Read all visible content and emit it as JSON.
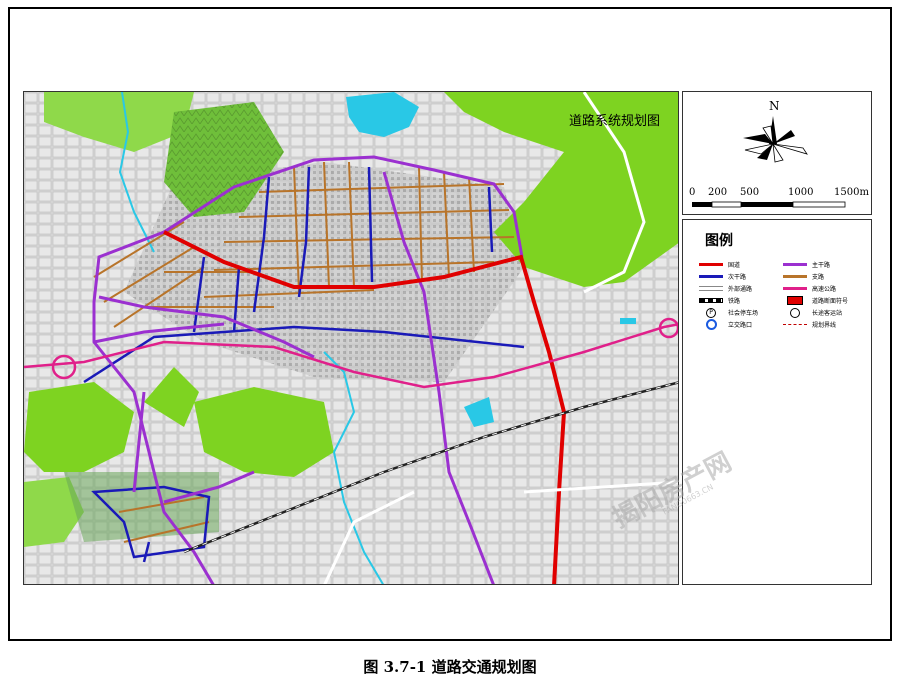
{
  "map": {
    "title": "道路系统规划图",
    "colors": {
      "national_road": "#e00000",
      "main_road": "#9b30d0",
      "secondary_road": "#1a1ab8",
      "branch_road": "#b8742a",
      "expressway": "#e0208a",
      "green": "#7ed321",
      "water": "#29c8e6",
      "railway": "#222222"
    }
  },
  "scale_bar": {
    "north_label": "N",
    "ticks": [
      "0",
      "200",
      "500",
      "1000",
      "1500m"
    ]
  },
  "legend": {
    "title": "图例",
    "items": [
      {
        "label": "国道",
        "symbol": "red-line-icon"
      },
      {
        "label": "主干路",
        "symbol": "purple-line-icon"
      },
      {
        "label": "次干路",
        "symbol": "blue-line-icon"
      },
      {
        "label": "支路",
        "symbol": "orange-line-icon"
      },
      {
        "label": "外部通路",
        "symbol": "gray-double-line-icon"
      },
      {
        "label": "高速公路",
        "symbol": "magenta-line-icon"
      },
      {
        "label": "铁路",
        "symbol": "railway-icon"
      },
      {
        "label": "道路断面符号",
        "symbol": "section-mark-icon"
      },
      {
        "label": "社会停车场",
        "symbol": "parking-icon"
      },
      {
        "label": "长途客运站",
        "symbol": "bus-station-icon"
      },
      {
        "label": "立交路口",
        "symbol": "interchange-icon"
      },
      {
        "label": "规划界线",
        "symbol": "boundary-dashed-icon"
      }
    ]
  },
  "caption": "图 3.7-1  道路交通规划图",
  "watermark": {
    "main": "揭阳房产网",
    "sub": "FANG0663.CN"
  }
}
